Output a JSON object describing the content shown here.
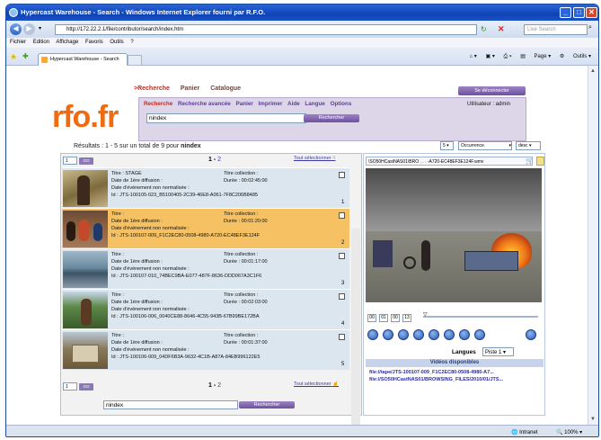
{
  "browser": {
    "title": "Hypercast Warehouse - Search - Windows Internet Explorer fourni par R.F.O.",
    "url": "http://172.22.2.1/file/contributor/search/index.htm",
    "live_search": "Live Search",
    "menu": [
      "Fichier",
      "Edition",
      "Affichage",
      "Favoris",
      "Outils",
      "?"
    ],
    "tab_title": "Hypercast Warehouse - Search",
    "tools": [
      "Page",
      "Outils"
    ],
    "status_zone": "Intranet",
    "zoom": "100%"
  },
  "app": {
    "logo": "rfo.fr",
    "nav_primary": [
      ">Recherche",
      "Panier",
      "Catalogue"
    ],
    "disconnect": "Se déconnecter",
    "nav_secondary": [
      "Recherche",
      "Recherche avancée",
      "Panier",
      "Imprimer",
      "Aide",
      "Langue",
      "Options"
    ],
    "user": "Utilisateur : admin",
    "query": "nindex",
    "search_button": "Rechercher"
  },
  "results": {
    "summary_prefix": "Résultats : 1 - 5 sur un total de 9 pour ",
    "summary_term": "nindex",
    "per_page": "5",
    "sort": "Occurrence.",
    "order": "desc",
    "page_input": "1",
    "go": "GO",
    "pages_current": "1",
    "pages_sep": " - ",
    "pages_next": "2",
    "select_all": "Tout sélectionner",
    "items": [
      {
        "title": "Titre : STAGE",
        "coll": "Titre collection :",
        "date": "Date de 1ère diffusion :",
        "duree": "Durée : 00:02:45:00",
        "event": "Date d'événement non normalisée :",
        "id": "Id : JTS-100105-023_B5100405-2C39-46E8-A061-7F8C206B8485",
        "idx": "1"
      },
      {
        "title": "Titre :",
        "coll": "Titre collection :",
        "date": "Date de 1ère diffusion :",
        "duree": "Durée : 00:01:20:00",
        "event": "Date d'événement non normalisée :",
        "id": "Id : JTS-100107-009_F1C2EC80-0508-4980-A720-EC48EF3E124F",
        "idx": "2"
      },
      {
        "title": "Titre :",
        "coll": "Titre collection :",
        "date": "Date de 1ère diffusion :",
        "duree": "Durée : 00:01:17:00",
        "event": "Date d'événement non normalisée :",
        "id": "Id : JTS-100107-010_74BEC9BA-E077-487F-8636-DDD067A3C1F6",
        "idx": "3"
      },
      {
        "title": "Titre :",
        "coll": "Titre collection :",
        "date": "Date de 1ère diffusion :",
        "duree": "Durée : 00:02:03:00",
        "event": "Date d'événement non normalisée :",
        "id": "Id : JTS-100106-006_0040CE88-8646-4C55-943B-67B99BE172BA",
        "idx": "4"
      },
      {
        "title": "Titre :",
        "coll": "Titre collection :",
        "date": "Date de 1ère diffusion :",
        "duree": "Durée : 00:01:37:00",
        "event": "Date d'événement non normalisée :",
        "id": "Id : JTS-100106-009_04DF6B3A-9632-4C1B-A87A-84EB996122E5",
        "idx": "5"
      }
    ],
    "bottom_query": "nindex"
  },
  "player": {
    "file_title": "\\SO50HCastNAS01\\BRO . . . -A720-EC48EF3E124F.wmv",
    "time": [
      "00",
      "01",
      "00",
      "13"
    ],
    "langues_label": "Langues",
    "piste": "Piste 1",
    "videos_label": "Vidéos disponibles",
    "files": [
      "file://tape/JTS-100107-009_F1C2EC80-0508-4980-A7...",
      "file://SO50HCastNAS01/BROWSING_FILES/2010/01/JTS..."
    ]
  },
  "colors": {
    "accent": "#f06a12",
    "selected": "#f6c163",
    "row": "#dbe6ef",
    "purple": "#6e50a0"
  }
}
